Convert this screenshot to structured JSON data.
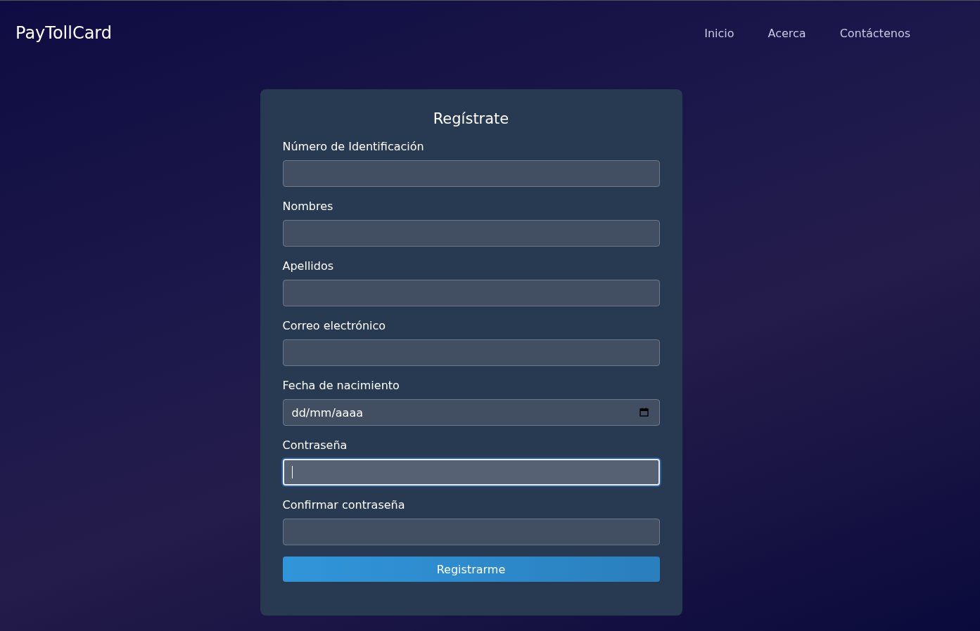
{
  "header": {
    "logo": "PayTollCard",
    "nav": [
      {
        "label": "Inicio"
      },
      {
        "label": "Acerca"
      },
      {
        "label": "Contáctenos"
      }
    ]
  },
  "form": {
    "title": "Regístrate",
    "fields": [
      {
        "label": "Número de Identificación",
        "kind": "text",
        "focused": false
      },
      {
        "label": "Nombres",
        "kind": "text",
        "focused": false
      },
      {
        "label": "Apellidos",
        "kind": "text",
        "focused": false
      },
      {
        "label": "Correo electrónico",
        "kind": "text",
        "focused": false
      },
      {
        "label": "Fecha de nacimiento",
        "kind": "date",
        "placeholder": "dd/mm/aaaa",
        "focused": false
      },
      {
        "label": "Contraseña",
        "kind": "text",
        "focused": true
      },
      {
        "label": "Confirmar contraseña",
        "kind": "text",
        "focused": false
      }
    ],
    "submit": "Registrarme"
  }
}
